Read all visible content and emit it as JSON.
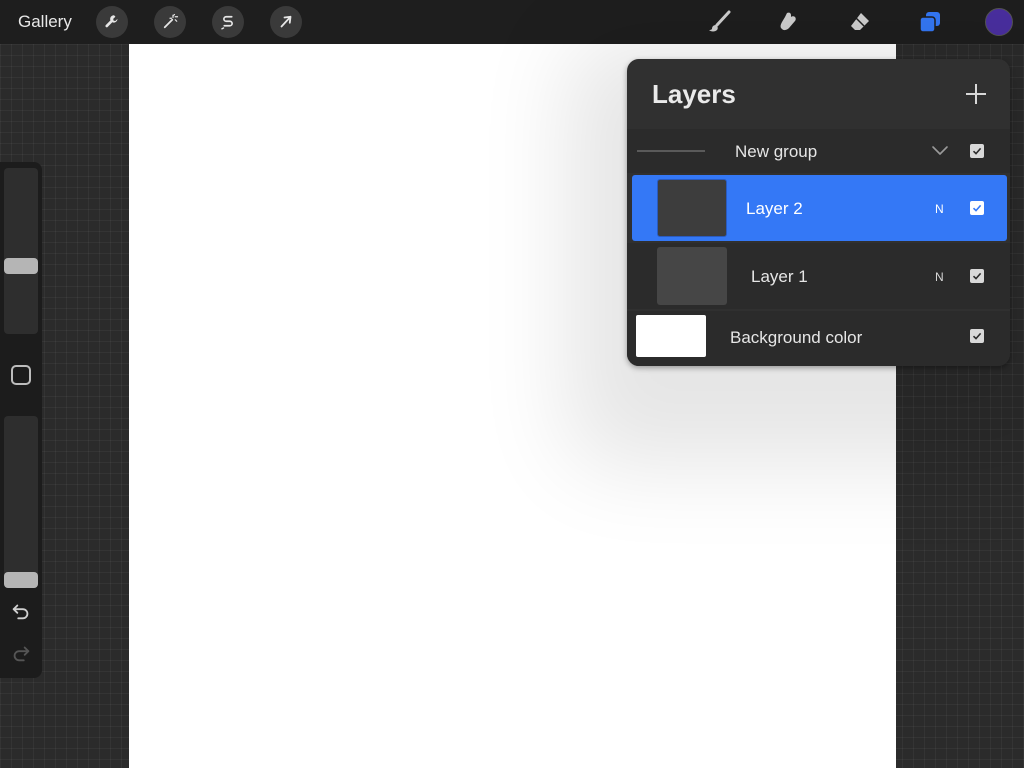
{
  "toolbar": {
    "gallery_label": "Gallery",
    "left_tools": [
      {
        "name": "actions",
        "icon": "wrench-icon"
      },
      {
        "name": "adjustments",
        "icon": "magic-wand-icon"
      },
      {
        "name": "selection",
        "icon": "selection-s-icon"
      },
      {
        "name": "transform",
        "icon": "arrow-cursor-icon"
      }
    ],
    "right_tools": [
      {
        "name": "brush",
        "icon": "brush-icon"
      },
      {
        "name": "smudge",
        "icon": "smudge-icon"
      },
      {
        "name": "eraser",
        "icon": "eraser-icon"
      },
      {
        "name": "layers",
        "icon": "layers-icon",
        "active": true
      }
    ],
    "current_color": "#4a2fa0",
    "active_color": "#3478f6"
  },
  "sidebar": {
    "brush_size_level": 0.4,
    "opacity_level": 0.0,
    "modify_icon": "square-icon",
    "undo_icon": "undo-icon",
    "redo_icon": "redo-icon"
  },
  "layers_panel": {
    "title": "Layers",
    "add_icon": "plus-icon",
    "group": {
      "label": "New group",
      "expanded": true,
      "visible": true
    },
    "layers": [
      {
        "label": "Layer 2",
        "blend": "N",
        "visible": true,
        "selected": true
      },
      {
        "label": "Layer 1",
        "blend": "N",
        "visible": true,
        "selected": false
      }
    ],
    "background": {
      "label": "Background color",
      "visible": true,
      "color": "#ffffff"
    }
  }
}
